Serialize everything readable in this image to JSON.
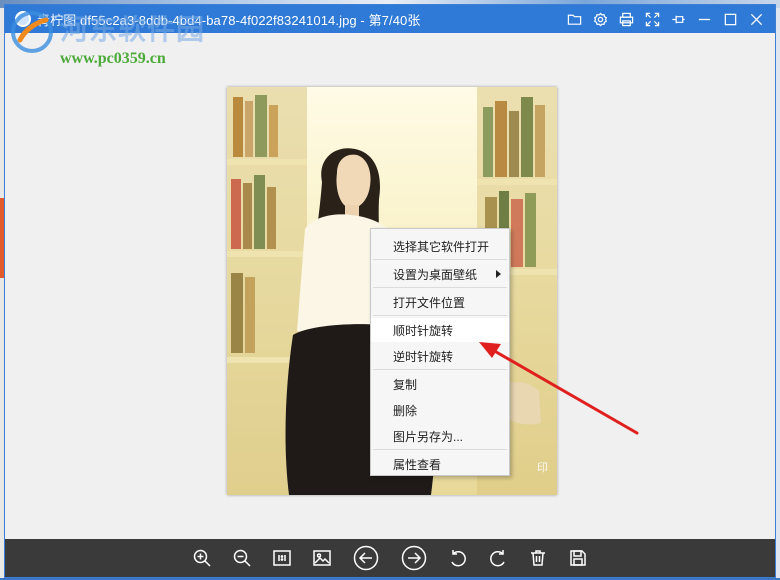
{
  "window": {
    "title": "青柠图  df55c2a3-8ddb-4bd4-ba78-4f022f83241014.jpg - 第7/40张"
  },
  "watermark": {
    "name": "河东软件园",
    "url": "www.pc0359.cn"
  },
  "title_tools": [
    "folder-icon",
    "gear-icon",
    "print-icon",
    "fullscreen-icon",
    "pin-icon",
    "minimize-icon",
    "maximize-icon",
    "close-icon"
  ],
  "context_menu": {
    "items": [
      {
        "label": "选择其它软件打开"
      },
      {
        "label": "设置为桌面壁纸"
      },
      {
        "label": "打开文件位置"
      },
      {
        "label": "顺时针旋转"
      },
      {
        "label": "逆时针旋转"
      },
      {
        "label": "复制"
      },
      {
        "label": "删除"
      },
      {
        "label": "图片另存为..."
      },
      {
        "label": "属性查看"
      }
    ]
  },
  "toolbar": {
    "icons": [
      "zoom-in-icon",
      "zoom-out-icon",
      "actual-size-icon",
      "image-icon",
      "previous-icon",
      "next-icon",
      "rotate-left-icon",
      "rotate-right-icon",
      "delete-icon",
      "save-icon"
    ]
  },
  "colors": {
    "titlebar": "#2f7ad6",
    "toolbar": "#3a3a3a",
    "annotation_arrow": "#e0201e"
  }
}
